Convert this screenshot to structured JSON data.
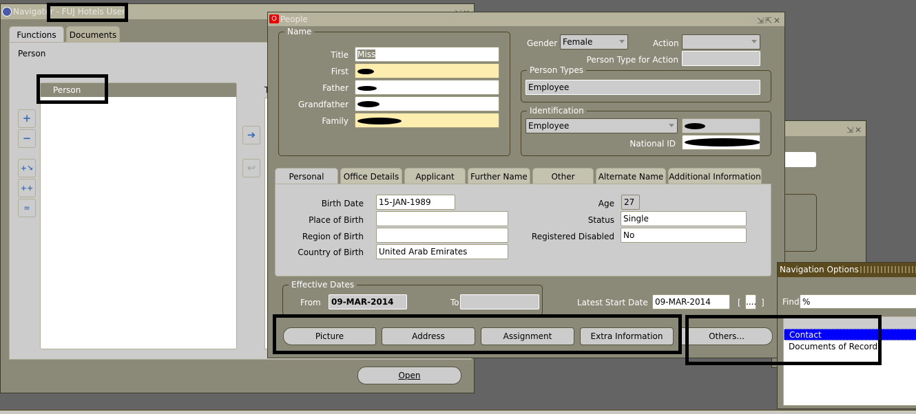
{
  "navigator": {
    "title": "Navigator - FUJ Hotels User",
    "tabs": [
      "Functions",
      "Documents"
    ],
    "section_label": "Person",
    "list_header": "Person",
    "cut_label": "T",
    "open_button": "Open"
  },
  "people": {
    "title": "People",
    "name_group": "Name",
    "name_fields": [
      {
        "label": "Title",
        "value": "Miss"
      },
      {
        "label": "First",
        "value": ""
      },
      {
        "label": "Father",
        "value": ""
      },
      {
        "label": "Grandfather",
        "value": ""
      },
      {
        "label": "Family",
        "value": ""
      }
    ],
    "gender_label": "Gender",
    "gender_value": "Female",
    "action_label": "Action",
    "action_value": "",
    "person_type_action_label": "Person Type for Action",
    "person_types_group": "Person Types",
    "person_type_value": "Employee",
    "identification_group": "Identification",
    "id_type_value": "Employee",
    "national_id_label": "National ID",
    "tabs": [
      "Personal",
      "Office Details",
      "Applicant",
      "Further Name",
      "Other",
      "Alternate Name",
      "Additional Information"
    ],
    "active_tab": "Personal",
    "personal": {
      "birth_date_label": "Birth Date",
      "birth_date": "15-JAN-1989",
      "place_label": "Place of Birth",
      "place": "",
      "region_label": "Region of Birth",
      "region": "",
      "country_label": "Country of Birth",
      "country": "United Arab Emirates",
      "age_label": "Age",
      "age": "27",
      "status_label": "Status",
      "status": "Single",
      "disabled_label": "Registered Disabled",
      "disabled": "No"
    },
    "effective_group": "Effective Dates",
    "from_label": "From",
    "from_value": "09-MAR-2014",
    "to_label": "To",
    "to_value": "",
    "latest_start_label": "Latest Start Date",
    "latest_start_value": "09-MAR-2014",
    "more_button": "....",
    "buttons": [
      "Picture",
      "Address",
      "Assignment",
      "Extra Information",
      "Others..."
    ]
  },
  "nav_options": {
    "title": "Navigation Options",
    "find_label": "Find",
    "find_value": "%",
    "items": [
      "Contact",
      "Documents of Record"
    ],
    "selected": "Contact"
  },
  "colors": {
    "window_bg": "#8b8a78",
    "panel": "#cccccc",
    "required": "#fdeeb0",
    "selection": "#0000ff",
    "nav_title": "#5a4a1e"
  }
}
